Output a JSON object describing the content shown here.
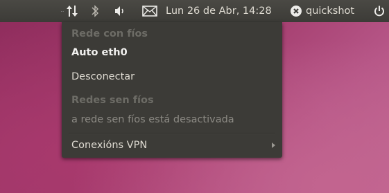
{
  "panel": {
    "icons": [
      "network-icon",
      "bluetooth-icon",
      "volume-icon",
      "mail-icon",
      "close-circle-icon",
      "power-icon"
    ],
    "clock": "Lun 26 de Abr, 14:28",
    "user": "quickshot"
  },
  "menu": {
    "wired_header": "Rede con fíos",
    "wired_connection": "Auto eth0",
    "disconnect": "Desconectar",
    "wireless_header": "Redes sen fíos",
    "wireless_disabled": "a rede sen fíos está desactivada",
    "vpn": "Conexións VPN"
  },
  "colors": {
    "panel_bg": "#3c3b37",
    "menu_bg": "#3c3b37",
    "text": "#dfdbd2",
    "header_text": "#6d6c66",
    "desktop": "#a23a6b"
  }
}
